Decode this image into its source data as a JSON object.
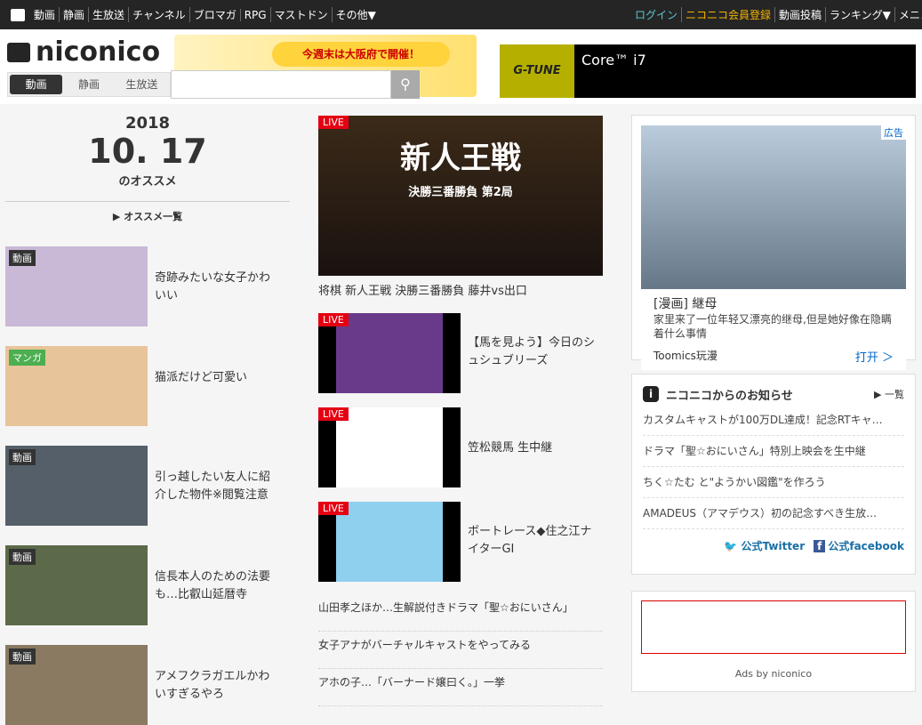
{
  "topbar": {
    "left": [
      "動画",
      "静画",
      "生放送",
      "チャンネル",
      "ブロマガ",
      "RPG",
      "マストドン",
      "その他▼"
    ],
    "login": "ログイン",
    "register": "ニコニコ会員登録",
    "right": [
      "動画投稿",
      "ランキング▼",
      "メニュー▼"
    ]
  },
  "header": {
    "logo": "niconico",
    "search_tabs": [
      "動画",
      "静画",
      "生放送"
    ],
    "search_placeholder": "",
    "banner_text": "今週末は大阪府で開催！",
    "ad_brand": "G-TUNE",
    "ad_text": "Core™ i7"
  },
  "recommend": {
    "year": "2018",
    "date": "10. 17",
    "subtitle": "のオススメ",
    "more": "オススメ一覧",
    "items": [
      {
        "badge": "動画",
        "title": "奇跡みたいな女子かわいい",
        "color": "#c9b8d6"
      },
      {
        "badge": "マンガ",
        "title": "猫派だけど可愛い",
        "color": "#e8c49a"
      },
      {
        "badge": "動画",
        "title": "引っ越したい友人に紹介した物件※閲覧注意",
        "color": "#555f6a"
      },
      {
        "badge": "動画",
        "title": "信長本人のための法要も…比叡山延暦寺",
        "color": "#5c6a4a"
      },
      {
        "badge": "動画",
        "title": "アメフクラガエルかわいすぎるやろ",
        "color": "#8a7a62"
      }
    ]
  },
  "live": {
    "badge": "LIVE",
    "hero_title": "新人王戦",
    "hero_sub": "決勝三番勝負 第2局",
    "hero_caption": "将棋 新人王戦 決勝三番勝負 藤井vs出口",
    "items": [
      {
        "title": "【馬を見よう】今日のシュシュブリーズ",
        "color": "#6a3a8a"
      },
      {
        "title": "笠松競馬 生中継",
        "color": "#ffffff"
      },
      {
        "title": "ボートレース◆住之江ナイターGI",
        "color": "#8fd0ee"
      }
    ],
    "text_items": [
      "山田孝之ほか…生解説付きドラマ「聖☆おにいさん」",
      "女子アナがバーチャルキャストをやってみる",
      "アホの子…「バーナード嬢曰く。」一挙"
    ]
  },
  "ad": {
    "label": "広告",
    "title": "[漫画] 継母",
    "desc": "家里来了一位年轻又漂亮的继母,但是她好像在隐瞒着什么事情",
    "sponsor": "Toomics玩漫",
    "cta": "打开 ＞"
  },
  "news": {
    "title": "ニコニコからのお知らせ",
    "all": "一覧",
    "items": [
      "カスタムキャストが100万DL達成！記念RTキャ…",
      "ドラマ「聖☆おにいさん」特別上映会を生中継",
      "ちく☆たむ と\"ようかい図鑑\"を作ろう",
      "AMADEUS（アマデウス）初の記念すべき生放…"
    ],
    "twitter": "公式Twitter",
    "facebook": "公式facebook"
  },
  "ads_by": "Ads by niconico"
}
